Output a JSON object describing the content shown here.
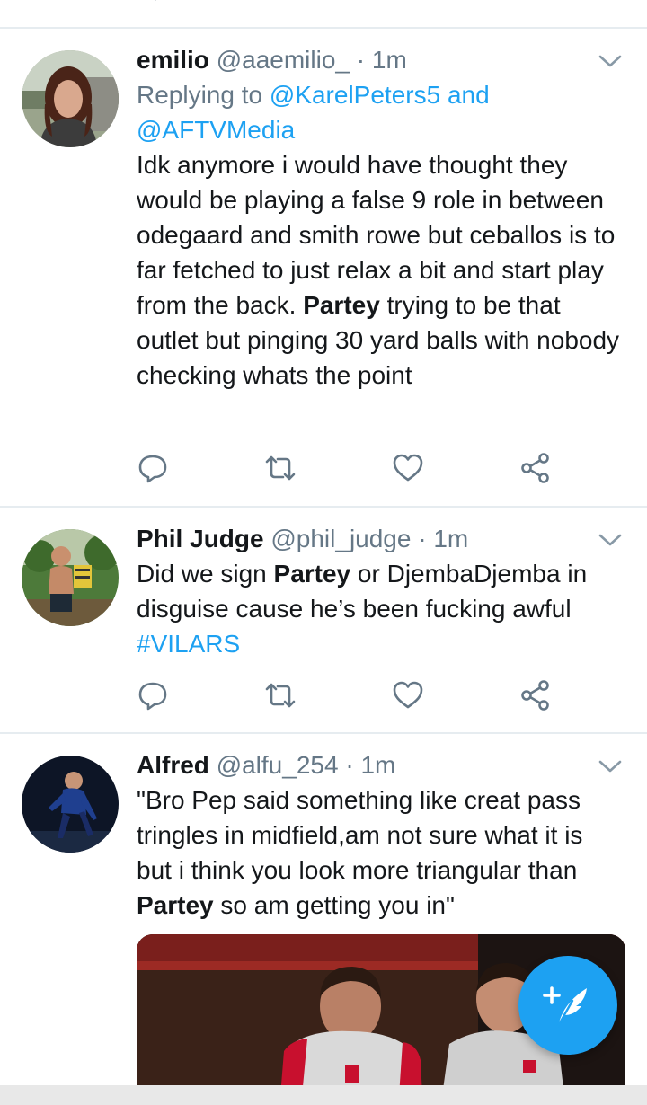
{
  "tweets": [
    {
      "name": "emilio",
      "handle": "@aaemilio_",
      "separator": "·",
      "time": "1m",
      "replying_to_prefix": "Replying to",
      "replying_to_user1": "@KarelPeters5",
      "replying_to_join": "and",
      "replying_to_user2": "@AFTVMedia",
      "text_part1": "Idk anymore i would have thought they would be playing a false 9 role in between odegaard and smith rowe but ceballos is to far fetched to just relax a bit and start play from the back.",
      "text_bold": "Partey",
      "text_part2": "trying to be that outlet but pinging 30 yard balls with nobody checking whats the point"
    },
    {
      "name": "Phil Judge",
      "handle": "@phil_judge",
      "separator": "·",
      "time": "1m",
      "text_part1": "Did we sign",
      "text_bold": "Partey",
      "text_part2": "or DjembaDjemba in disguise cause he’s been fucking awful",
      "hashtag": "#VILARS"
    },
    {
      "name": "Alfred",
      "handle": "@alfu_254",
      "separator": "·",
      "time": "1m",
      "text_part1": "\"Bro Pep said something like creat pass tringles in midfield,am not sure what it is but i think you look more triangular than",
      "text_bold": "Partey",
      "text_part2": "so am getting you in\""
    }
  ],
  "icons": {
    "reply": "reply-icon",
    "retweet": "retweet-icon",
    "like": "heart-icon",
    "share": "share-icon",
    "menu": "chevron-down-icon",
    "compose": "compose-tweet-icon"
  },
  "colors": {
    "accent": "#1da1f2",
    "secondary_text": "#657786",
    "icon_gray": "#657786",
    "divider": "#e6ecf0"
  }
}
